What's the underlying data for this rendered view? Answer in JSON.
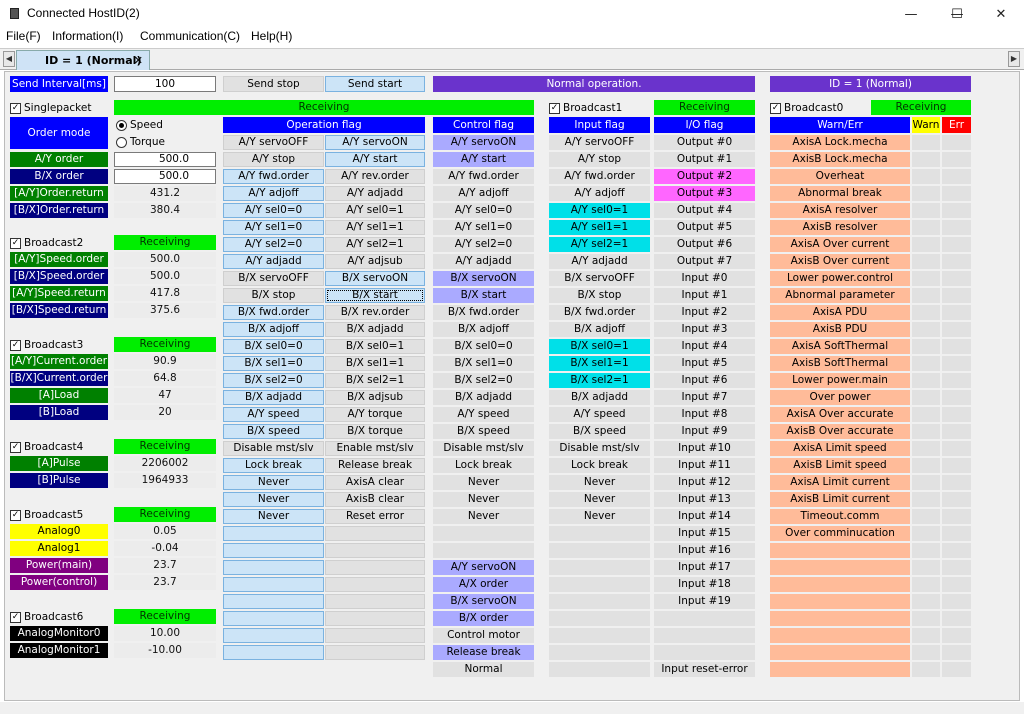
{
  "window": {
    "title": "Connected  HostID(2)",
    "minimize": "—",
    "maximize": "☐",
    "close": "✕"
  },
  "menu": [
    "File(F)",
    "Information(I)",
    "Communication(C)",
    "Help(H)"
  ],
  "tab": {
    "label": "ID = 1 (Normal)",
    "close": "✕",
    "left_arrow": "◀",
    "right_arrow": "▶"
  },
  "top": {
    "send_interval_label": "Send Interval[ms]",
    "send_interval_value": "100",
    "send_stop": "Send stop",
    "send_start": "Send start",
    "status": "Normal operation.",
    "id_status": "ID = 1 (Normal)"
  },
  "singlepacket": {
    "label": "Singlepacket",
    "receiving": "Receiving",
    "order_mode": "Order mode",
    "speed": "Speed",
    "torque": "Torque",
    "rows": [
      {
        "label": "A/Y order",
        "value": "500.0"
      },
      {
        "label": "B/X order",
        "value": "500.0"
      },
      {
        "label": "[A/Y]Order.return",
        "value": "431.2"
      },
      {
        "label": "[B/X]Order.return",
        "value": "380.4"
      }
    ]
  },
  "broadcast2": {
    "label": "Broadcast2",
    "receiving": "Receiving",
    "rows": [
      {
        "label": "[A/Y]Speed.order",
        "value": "500.0"
      },
      {
        "label": "[B/X]Speed.order",
        "value": "500.0"
      },
      {
        "label": "[A/Y]Speed.return",
        "value": "417.8"
      },
      {
        "label": "[B/X]Speed.return",
        "value": "375.6"
      }
    ]
  },
  "broadcast3": {
    "label": "Broadcast3",
    "receiving": "Receiving",
    "rows": [
      {
        "label": "[A/Y]Current.order",
        "value": "90.9"
      },
      {
        "label": "[B/X]Current.order",
        "value": "64.8"
      },
      {
        "label": "[A]Load",
        "value": "47"
      },
      {
        "label": "[B]Load",
        "value": "20"
      }
    ]
  },
  "broadcast4": {
    "label": "Broadcast4",
    "receiving": "Receiving",
    "rows": [
      {
        "label": "[A]Pulse",
        "value": "2206002"
      },
      {
        "label": "[B]Pulse",
        "value": "1964933"
      }
    ]
  },
  "broadcast5": {
    "label": "Broadcast5",
    "receiving": "Receiving",
    "rows": [
      {
        "label": "Analog0",
        "value": "0.05"
      },
      {
        "label": "Analog1",
        "value": "-0.04"
      },
      {
        "label": "Power(main)",
        "value": "23.7"
      },
      {
        "label": "Power(control)",
        "value": "23.7"
      }
    ]
  },
  "broadcast6": {
    "label": "Broadcast6",
    "receiving": "Receiving",
    "rows": [
      {
        "label": "AnalogMonitor0",
        "value": "10.00"
      },
      {
        "label": "AnalogMonitor1",
        "value": "-10.00"
      }
    ]
  },
  "operation_flag": {
    "header": "Operation flag",
    "left": [
      "A/Y servoOFF",
      "A/Y stop",
      "A/Y fwd.order",
      "A/Y adjoff",
      "A/Y sel0=0",
      "A/Y sel1=0",
      "A/Y sel2=0",
      "A/Y adjadd",
      "B/X servoOFF",
      "B/X stop",
      "B/X fwd.order",
      "B/X adjoff",
      "B/X sel0=0",
      "B/X sel1=0",
      "B/X sel2=0",
      "B/X adjadd",
      "A/Y speed",
      "B/X speed",
      "Disable mst/slv",
      "Lock break",
      "Never",
      "Never",
      "Never",
      "",
      "",
      "",
      "",
      "",
      "",
      "",
      ""
    ],
    "right": [
      "A/Y servoON",
      "A/Y start",
      "A/Y rev.order",
      "A/Y adjadd",
      "A/Y sel0=1",
      "A/Y sel1=1",
      "A/Y sel2=1",
      "A/Y adjsub",
      "B/X servoON",
      "B/X start",
      "B/X rev.order",
      "B/X adjadd",
      "B/X sel0=1",
      "B/X sel1=1",
      "B/X sel2=1",
      "B/X adjsub",
      "A/Y torque",
      "B/X torque",
      "Enable mst/slv",
      "Release break",
      "AxisA clear",
      "AxisB clear",
      "Reset error",
      "",
      "",
      "",
      "",
      "",
      "",
      "",
      ""
    ]
  },
  "control_flag": {
    "header": "Control flag",
    "items": [
      "A/Y servoON",
      "A/Y start",
      "A/Y fwd.order",
      "A/Y adjoff",
      "A/Y sel0=0",
      "A/Y sel1=0",
      "A/Y sel2=0",
      "A/Y adjadd",
      "B/X servoON",
      "B/X start",
      "B/X fwd.order",
      "B/X adjoff",
      "B/X sel0=0",
      "B/X sel1=0",
      "B/X sel2=0",
      "B/X adjadd",
      "A/Y speed",
      "B/X speed",
      "Disable mst/slv",
      "Lock break",
      "Never",
      "Never",
      "Never",
      "",
      "",
      "A/Y servoON",
      "A/X order",
      "B/X servoON",
      "B/X order",
      "Control motor",
      "Release break",
      "Normal"
    ],
    "active": [
      true,
      true,
      false,
      false,
      false,
      false,
      false,
      false,
      true,
      true,
      false,
      false,
      false,
      false,
      false,
      false,
      false,
      false,
      false,
      false,
      false,
      false,
      false,
      false,
      false,
      true,
      true,
      true,
      true,
      false,
      true,
      false
    ]
  },
  "broadcast1": {
    "label": "Broadcast1",
    "receiving": "Receiving",
    "input_flag_header": "Input flag",
    "input_flags": [
      "A/Y servoOFF",
      "A/Y stop",
      "A/Y fwd.order",
      "A/Y adjoff",
      "A/Y sel0=1",
      "A/Y sel1=1",
      "A/Y sel2=1",
      "A/Y adjadd",
      "B/X servoOFF",
      "B/X stop",
      "B/X fwd.order",
      "B/X adjoff",
      "B/X sel0=1",
      "B/X sel1=1",
      "B/X sel2=1",
      "B/X adjadd",
      "A/Y speed",
      "B/X speed",
      "Disable mst/slv",
      "Lock break",
      "Never",
      "Never",
      "Never",
      "",
      "",
      "",
      "",
      "",
      "",
      "",
      "",
      ""
    ],
    "input_active": [
      false,
      false,
      false,
      false,
      true,
      true,
      true,
      false,
      false,
      false,
      false,
      false,
      true,
      true,
      true,
      false,
      false,
      false,
      false,
      false,
      false,
      false,
      false,
      false,
      false,
      false,
      false,
      false,
      false,
      false,
      false,
      false
    ],
    "io_flag_header": "I/O flag",
    "io_flags": [
      "Output #0",
      "Output #1",
      "Output #2",
      "Output #3",
      "Output #4",
      "Output #5",
      "Output #6",
      "Output #7",
      "Input #0",
      "Input #1",
      "Input #2",
      "Input #3",
      "Input #4",
      "Input #5",
      "Input #6",
      "Input #7",
      "Input #8",
      "Input #9",
      "Input #10",
      "Input #11",
      "Input #12",
      "Input #13",
      "Input #14",
      "Input #15",
      "Input #16",
      "Input #17",
      "Input #18",
      "Input #19",
      "",
      "",
      "",
      "Input reset-error"
    ],
    "io_active": [
      false,
      false,
      true,
      true,
      false,
      false,
      false,
      false,
      false,
      false,
      false,
      false,
      false,
      false,
      false,
      false,
      false,
      false,
      false,
      false,
      false,
      false,
      false,
      false,
      false,
      false,
      false,
      false,
      false,
      false,
      false,
      false
    ]
  },
  "broadcast0": {
    "label": "Broadcast0",
    "receiving": "Receiving",
    "warn_err_header": "Warn/Err",
    "warn": "Warn",
    "err": "Err",
    "items": [
      "AxisA Lock.mecha",
      "AxisB Lock.mecha",
      "Overheat",
      "Abnormal break",
      "AxisA resolver",
      "AxisB resolver",
      "AxisA Over current",
      "AxisB Over current",
      "Lower power.control",
      "Abnormal parameter",
      "AxisA PDU",
      "AxisB PDU",
      "AxisA SoftThermal",
      "AxisB SoftThermal",
      "Lower power.main",
      "Over power",
      "AxisA Over accurate",
      "AxisB Over accurate",
      "AxisA Limit speed",
      "AxisB Limit speed",
      "AxisA Limit current",
      "AxisB Limit current",
      "Timeout.comm",
      "Over comminucation",
      "",
      "",
      "",
      "",
      "",
      "",
      "",
      ""
    ]
  },
  "colors": {
    "blue": "#0000ff",
    "green": "#00ee00",
    "active_flag": "#aaaaff",
    "cyan": "#00e0e8",
    "magenta": "#ff66ff",
    "salmon": "#ffbb99",
    "purple": "#6a33cc"
  }
}
